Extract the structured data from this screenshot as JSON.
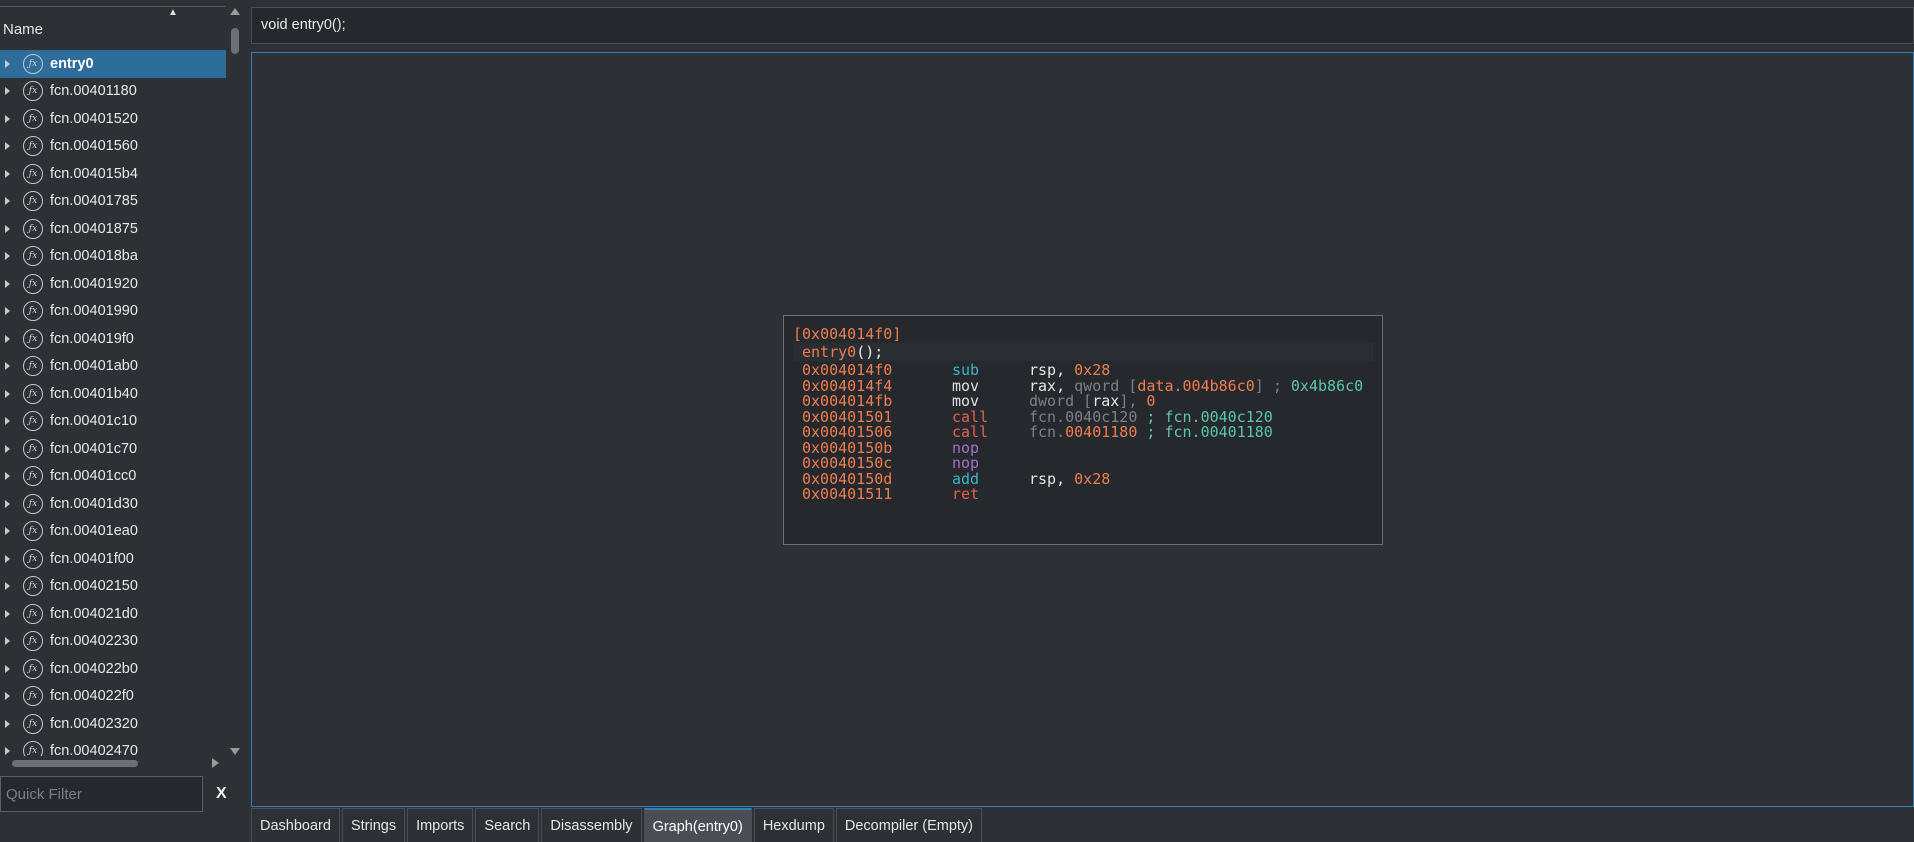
{
  "sidebar": {
    "header": {
      "name_label": "Name",
      "sort_indicator": "▲"
    },
    "functions": [
      {
        "label": "entry0",
        "selected": true
      },
      {
        "label": "fcn.00401180"
      },
      {
        "label": "fcn.00401520"
      },
      {
        "label": "fcn.00401560"
      },
      {
        "label": "fcn.004015b4"
      },
      {
        "label": "fcn.00401785"
      },
      {
        "label": "fcn.00401875"
      },
      {
        "label": "fcn.004018ba"
      },
      {
        "label": "fcn.00401920"
      },
      {
        "label": "fcn.00401990"
      },
      {
        "label": "fcn.004019f0"
      },
      {
        "label": "fcn.00401ab0"
      },
      {
        "label": "fcn.00401b40"
      },
      {
        "label": "fcn.00401c10"
      },
      {
        "label": "fcn.00401c70"
      },
      {
        "label": "fcn.00401cc0"
      },
      {
        "label": "fcn.00401d30"
      },
      {
        "label": "fcn.00401ea0"
      },
      {
        "label": "fcn.00401f00"
      },
      {
        "label": "fcn.00402150"
      },
      {
        "label": "fcn.004021d0"
      },
      {
        "label": "fcn.00402230"
      },
      {
        "label": "fcn.004022b0"
      },
      {
        "label": "fcn.004022f0"
      },
      {
        "label": "fcn.00402320"
      },
      {
        "label": "fcn.00402470"
      }
    ],
    "function_icon": "function-icon",
    "quick_filter": {
      "placeholder": "Quick Filter",
      "value": ""
    },
    "clear_label": "X"
  },
  "signature_bar": {
    "text": "void entry0();"
  },
  "graph": {
    "node": {
      "title": "[0x004014f0]",
      "entry_name": "entry0",
      "entry_suffix": "();",
      "instructions": [
        {
          "addr": "0x004014f0",
          "mnemonic": "sub",
          "operands": [
            {
              "t": "rsp, ",
              "c": "white"
            },
            {
              "t": "0x28",
              "c": "orange"
            }
          ],
          "mclass": "cyan"
        },
        {
          "addr": "0x004014f4",
          "mnemonic": "mov",
          "operands": [
            {
              "t": "rax, ",
              "c": "white"
            },
            {
              "t": "qword [",
              "c": "dim"
            },
            {
              "t": "data.004b86c0",
              "c": "orange"
            },
            {
              "t": "] ",
              "c": "dim"
            },
            {
              "t": "; ",
              "c": "dim"
            },
            {
              "t": "0x4b86c0",
              "c": "green"
            }
          ],
          "mclass": "white"
        },
        {
          "addr": "0x004014fb",
          "mnemonic": "mov",
          "operands": [
            {
              "t": "dword [",
              "c": "dim"
            },
            {
              "t": "rax",
              "c": "white"
            },
            {
              "t": "], ",
              "c": "dim"
            },
            {
              "t": "0",
              "c": "orange"
            }
          ],
          "mclass": "white"
        },
        {
          "addr": "0x00401501",
          "mnemonic": "call",
          "operands": [
            {
              "t": "fcn.0040c120 ",
              "c": "dim"
            },
            {
              "t": "; fcn.0040c120",
              "c": "green"
            }
          ],
          "mclass": "red"
        },
        {
          "addr": "0x00401506",
          "mnemonic": "call",
          "operands": [
            {
              "t": "fcn.",
              "c": "dim"
            },
            {
              "t": "00401180",
              "c": "orange"
            },
            {
              "t": " ; fcn.00401180",
              "c": "green"
            }
          ],
          "mclass": "red"
        },
        {
          "addr": "0x0040150b",
          "mnemonic": "nop",
          "operands": [],
          "mclass": "purple"
        },
        {
          "addr": "0x0040150c",
          "mnemonic": "nop",
          "operands": [],
          "mclass": "purple"
        },
        {
          "addr": "0x0040150d",
          "mnemonic": "add",
          "operands": [
            {
              "t": "rsp, ",
              "c": "white"
            },
            {
              "t": "0x28",
              "c": "orange"
            }
          ],
          "mclass": "cyan"
        },
        {
          "addr": "0x00401511",
          "mnemonic": "ret",
          "operands": [],
          "mclass": "red"
        }
      ]
    }
  },
  "tabs": [
    {
      "label": "Dashboard"
    },
    {
      "label": "Strings"
    },
    {
      "label": "Imports"
    },
    {
      "label": "Search"
    },
    {
      "label": "Disassembly"
    },
    {
      "label": "Graph(entry0)",
      "active": true
    },
    {
      "label": "Hexdump"
    },
    {
      "label": "Decompiler (Empty)"
    }
  ],
  "colors": {
    "selection": "#2e6d99",
    "accent_border": "#2e7fb5",
    "address": "#ef7e4f",
    "mnemonic_arith": "#40b3c6",
    "mnemonic_call": "#e8604d",
    "mnemonic_nop": "#a570c8",
    "comment": "#5ac7a8"
  }
}
